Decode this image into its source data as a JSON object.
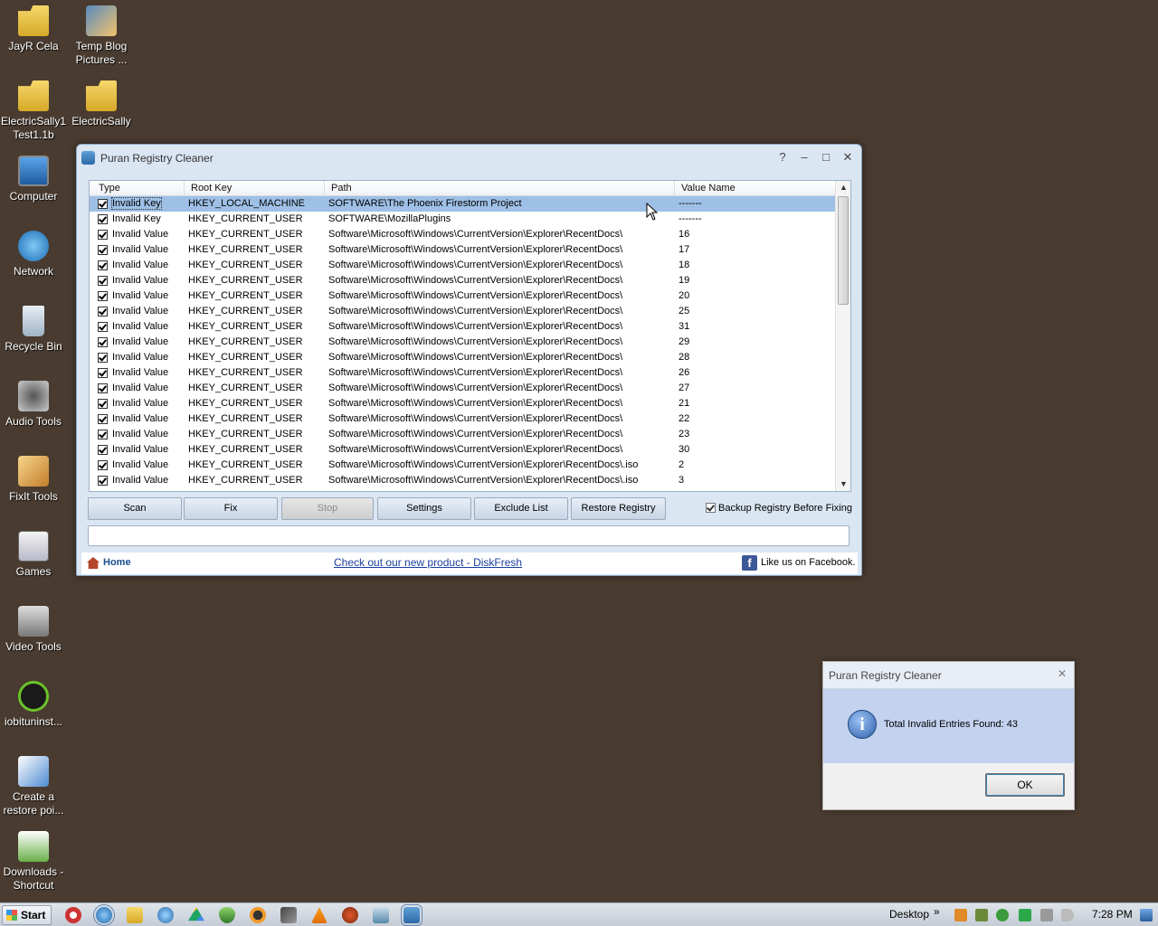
{
  "desktop": {
    "icons": [
      {
        "label": "JayR Cela",
        "icon": "folder-icon"
      },
      {
        "label": "Temp Blog Pictures ...",
        "icon": "image-shortcut-icon"
      },
      {
        "label": "ElectricSally1 Test1.1b",
        "icon": "folder-icon"
      },
      {
        "label": "ElectricSally",
        "icon": "folder-icon"
      },
      {
        "label": "Computer",
        "icon": "computer-icon"
      },
      {
        "label": "Network",
        "icon": "network-icon"
      },
      {
        "label": "Recycle Bin",
        "icon": "recycle-bin-icon"
      },
      {
        "label": "Audio Tools",
        "icon": "speaker-icon"
      },
      {
        "label": "FixIt  Tools",
        "icon": "tools-icon"
      },
      {
        "label": "Games",
        "icon": "games-icon"
      },
      {
        "label": "Video Tools",
        "icon": "video-camera-icon"
      },
      {
        "label": "iobituninst...",
        "icon": "uninstaller-icon"
      },
      {
        "label": "Create a restore poi...",
        "icon": "restore-icon"
      },
      {
        "label": "Downloads - Shortcut",
        "icon": "downloads-icon"
      }
    ]
  },
  "window": {
    "title": "Puran Registry Cleaner",
    "help": "?",
    "minimize": "–",
    "maximize": "□",
    "close": "✕",
    "columns": {
      "type": "Type",
      "root_key": "Root Key",
      "path": "Path",
      "value_name": "Value Name"
    },
    "rows": [
      {
        "type": "Invalid Key",
        "root": "HKEY_LOCAL_MACHINE",
        "path": "SOFTWARE\\The Phoenix Firestorm Project",
        "value": "-------",
        "checked": true,
        "selected": true
      },
      {
        "type": "Invalid Key",
        "root": "HKEY_CURRENT_USER",
        "path": "SOFTWARE\\MozillaPlugins",
        "value": "-------",
        "checked": true
      },
      {
        "type": "Invalid Value",
        "root": "HKEY_CURRENT_USER",
        "path": "Software\\Microsoft\\Windows\\CurrentVersion\\Explorer\\RecentDocs\\",
        "value": "16",
        "checked": true
      },
      {
        "type": "Invalid Value",
        "root": "HKEY_CURRENT_USER",
        "path": "Software\\Microsoft\\Windows\\CurrentVersion\\Explorer\\RecentDocs\\",
        "value": "17",
        "checked": true
      },
      {
        "type": "Invalid Value",
        "root": "HKEY_CURRENT_USER",
        "path": "Software\\Microsoft\\Windows\\CurrentVersion\\Explorer\\RecentDocs\\",
        "value": "18",
        "checked": true
      },
      {
        "type": "Invalid Value",
        "root": "HKEY_CURRENT_USER",
        "path": "Software\\Microsoft\\Windows\\CurrentVersion\\Explorer\\RecentDocs\\",
        "value": "19",
        "checked": true
      },
      {
        "type": "Invalid Value",
        "root": "HKEY_CURRENT_USER",
        "path": "Software\\Microsoft\\Windows\\CurrentVersion\\Explorer\\RecentDocs\\",
        "value": "20",
        "checked": true
      },
      {
        "type": "Invalid Value",
        "root": "HKEY_CURRENT_USER",
        "path": "Software\\Microsoft\\Windows\\CurrentVersion\\Explorer\\RecentDocs\\",
        "value": "25",
        "checked": true
      },
      {
        "type": "Invalid Value",
        "root": "HKEY_CURRENT_USER",
        "path": "Software\\Microsoft\\Windows\\CurrentVersion\\Explorer\\RecentDocs\\",
        "value": "31",
        "checked": true
      },
      {
        "type": "Invalid Value",
        "root": "HKEY_CURRENT_USER",
        "path": "Software\\Microsoft\\Windows\\CurrentVersion\\Explorer\\RecentDocs\\",
        "value": "29",
        "checked": true
      },
      {
        "type": "Invalid Value",
        "root": "HKEY_CURRENT_USER",
        "path": "Software\\Microsoft\\Windows\\CurrentVersion\\Explorer\\RecentDocs\\",
        "value": "28",
        "checked": true
      },
      {
        "type": "Invalid Value",
        "root": "HKEY_CURRENT_USER",
        "path": "Software\\Microsoft\\Windows\\CurrentVersion\\Explorer\\RecentDocs\\",
        "value": "26",
        "checked": true
      },
      {
        "type": "Invalid Value",
        "root": "HKEY_CURRENT_USER",
        "path": "Software\\Microsoft\\Windows\\CurrentVersion\\Explorer\\RecentDocs\\",
        "value": "27",
        "checked": true
      },
      {
        "type": "Invalid Value",
        "root": "HKEY_CURRENT_USER",
        "path": "Software\\Microsoft\\Windows\\CurrentVersion\\Explorer\\RecentDocs\\",
        "value": "21",
        "checked": true
      },
      {
        "type": "Invalid Value",
        "root": "HKEY_CURRENT_USER",
        "path": "Software\\Microsoft\\Windows\\CurrentVersion\\Explorer\\RecentDocs\\",
        "value": "22",
        "checked": true
      },
      {
        "type": "Invalid Value",
        "root": "HKEY_CURRENT_USER",
        "path": "Software\\Microsoft\\Windows\\CurrentVersion\\Explorer\\RecentDocs\\",
        "value": "23",
        "checked": true
      },
      {
        "type": "Invalid Value",
        "root": "HKEY_CURRENT_USER",
        "path": "Software\\Microsoft\\Windows\\CurrentVersion\\Explorer\\RecentDocs\\",
        "value": "30",
        "checked": true
      },
      {
        "type": "Invalid Value",
        "root": "HKEY_CURRENT_USER",
        "path": "Software\\Microsoft\\Windows\\CurrentVersion\\Explorer\\RecentDocs\\.iso",
        "value": "2",
        "checked": true
      },
      {
        "type": "Invalid Value",
        "root": "HKEY_CURRENT_USER",
        "path": "Software\\Microsoft\\Windows\\CurrentVersion\\Explorer\\RecentDocs\\.iso",
        "value": "3",
        "checked": true
      }
    ],
    "buttons": {
      "scan": "Scan",
      "fix": "Fix",
      "stop": "Stop",
      "settings": "Settings",
      "exclude_list": "Exclude List",
      "restore_registry": "Restore Registry"
    },
    "backup_checkbox": {
      "label": "Backup Registry Before Fixing",
      "checked": true
    },
    "status_text": "",
    "footer": {
      "home": "Home",
      "promo": "Check out our new product - DiskFresh",
      "facebook": "Like us on Facebook."
    }
  },
  "dialog": {
    "title": "Puran Registry Cleaner",
    "close": "✕",
    "message": "Total Invalid Entries Found: 43",
    "ok": "OK",
    "icon": "info-icon"
  },
  "taskbar": {
    "start": "Start",
    "icons": [
      "opera-icon",
      "browser-icon",
      "explorer-folder-icon",
      "globe-icon",
      "drive-icon",
      "shield-icon",
      "headphones-icon",
      "pen-icon",
      "vlc-icon",
      "firefox-icon",
      "remote-icon",
      "puran-icon"
    ],
    "desktop_label": "Desktop",
    "chevron": "»",
    "clock": "7:28 PM"
  },
  "colors": {
    "desktop_bg": "#493b30",
    "selection": "#9ec0e6",
    "window_frame": "#dbe6f3",
    "dialog_band": "#c3d2ef"
  }
}
